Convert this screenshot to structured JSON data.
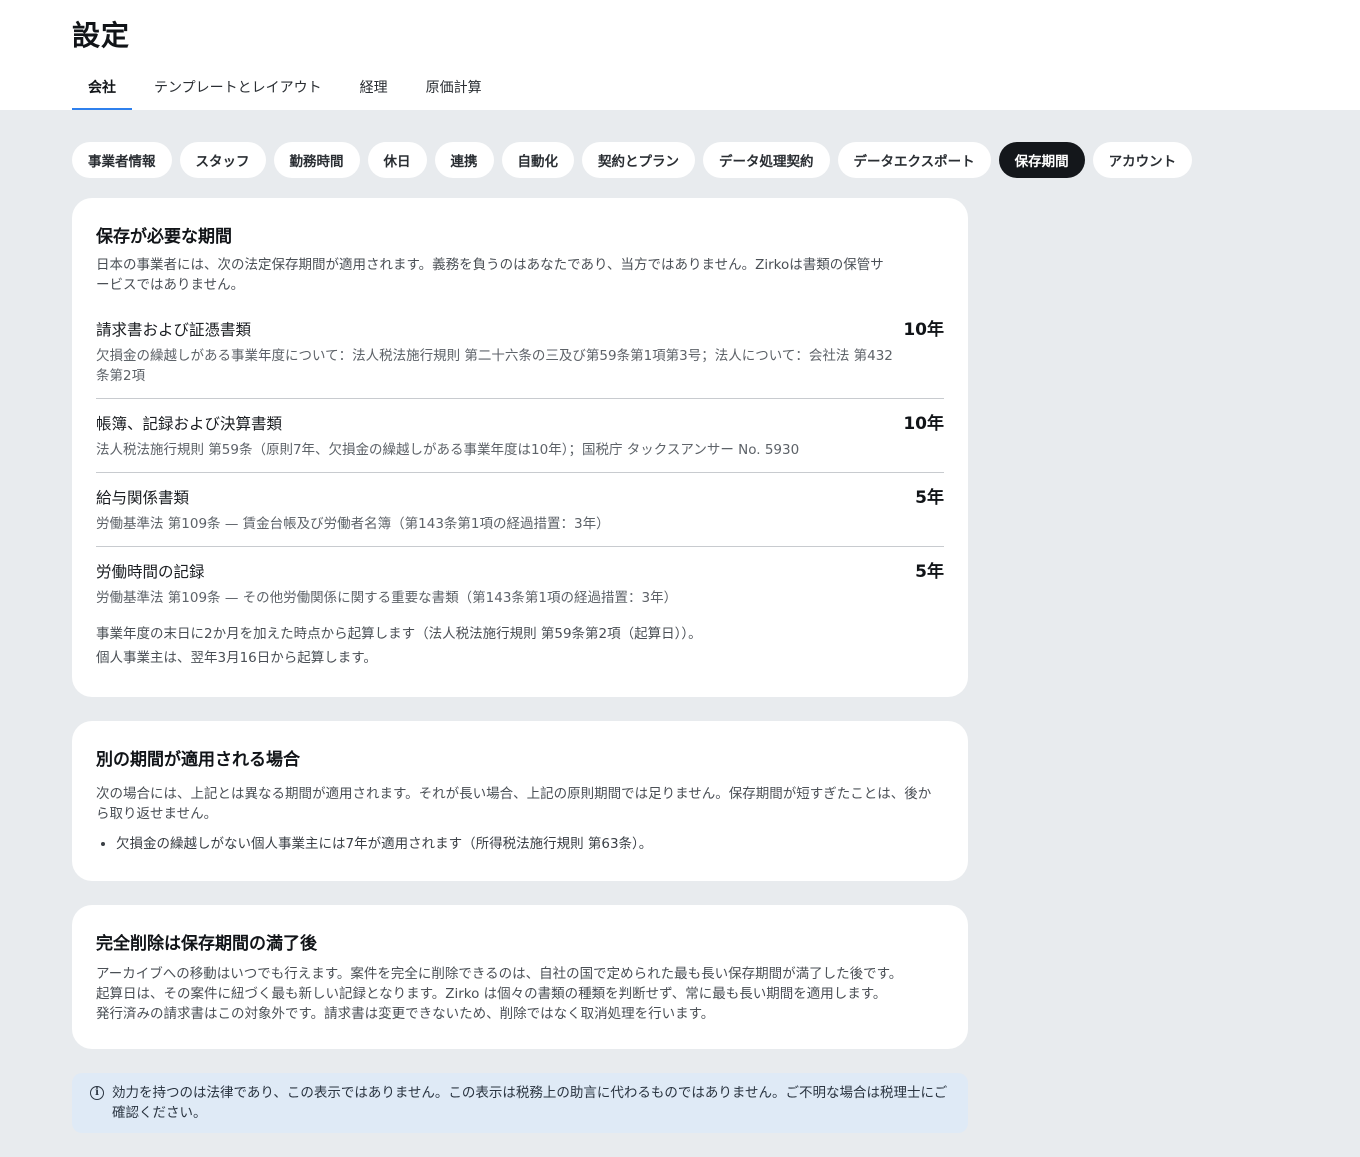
{
  "page": {
    "title": "設定"
  },
  "tabs": [
    {
      "label": "会社",
      "active": true
    },
    {
      "label": "テンプレートとレイアウト",
      "active": false
    },
    {
      "label": "経理",
      "active": false
    },
    {
      "label": "原価計算",
      "active": false
    }
  ],
  "subnav": [
    {
      "label": "事業者情報",
      "active": false
    },
    {
      "label": "スタッフ",
      "active": false
    },
    {
      "label": "勤務時間",
      "active": false
    },
    {
      "label": "休日",
      "active": false
    },
    {
      "label": "連携",
      "active": false
    },
    {
      "label": "自動化",
      "active": false
    },
    {
      "label": "契約とプラン",
      "active": false
    },
    {
      "label": "データ処理契約",
      "active": false
    },
    {
      "label": "データエクスポート",
      "active": false
    },
    {
      "label": "保存期間",
      "active": true
    },
    {
      "label": "アカウント",
      "active": false
    }
  ],
  "retention": {
    "title": "保存が必要な期間",
    "description": "日本の事業者には、次の法定保存期間が適用されます。義務を負うのはあなたであり、当方ではありません。Zirkoは書類の保管サービスではありません。",
    "items": [
      {
        "name": "請求書および証憑書類",
        "years": "10年",
        "law": "欠損金の繰越しがある事業年度について：法人税法施行規則 第二十六条の三及び第59条第1項第3号；法人について：会社法 第432条第2項"
      },
      {
        "name": "帳簿、記録および決算書類",
        "years": "10年",
        "law": "法人税法施行規則 第59条（原則7年、欠損金の繰越しがある事業年度は10年）；国税庁 タックスアンサー No. 5930"
      },
      {
        "name": "給与関係書類",
        "years": "5年",
        "law": "労働基準法 第109条 — 賃金台帳及び労働者名簿（第143条第1項の経過措置：3年）"
      },
      {
        "name": "労働時間の記録",
        "years": "5年",
        "law": "労働基準法 第109条 — その他労働関係に関する重要な書類（第143条第1項の経過措置：3年）"
      }
    ],
    "note_1": "事業年度の末日に2か月を加えた時点から起算します（法人税法施行規則 第59条第2項（起算日））。",
    "note_2": "個人事業主は、翌年3月16日から起算します。"
  },
  "other_period": {
    "title": "別の期間が適用される場合",
    "description": "次の場合には、上記とは異なる期間が適用されます。それが長い場合、上記の原則期間では足りません。保存期間が短すぎたことは、後から取り返せません。",
    "bullets": [
      "欠損金の繰越しがない個人事業主には7年が適用されます（所得税法施行規則 第63条）。"
    ]
  },
  "deletion": {
    "title": "完全削除は保存期間の満了後",
    "line_1": "アーカイブへの移動はいつでも行えます。案件を完全に削除できるのは、自社の国で定められた最も長い保存期間が満了した後です。",
    "line_2": "起算日は、その案件に紐づく最も新しい記録となります。Zirko は個々の書類の種類を判断せず、常に最も長い期間を適用します。",
    "line_3": "発行済みの請求書はこの対象外です。請求書は変更できないため、削除ではなく取消処理を行います。"
  },
  "notice": {
    "icon": "info-icon",
    "text": "効力を持つのは法律であり、この表示ではありません。この表示は税務上の助言に代わるものではありません。ご不明な場合は税理士にご確認ください。"
  }
}
